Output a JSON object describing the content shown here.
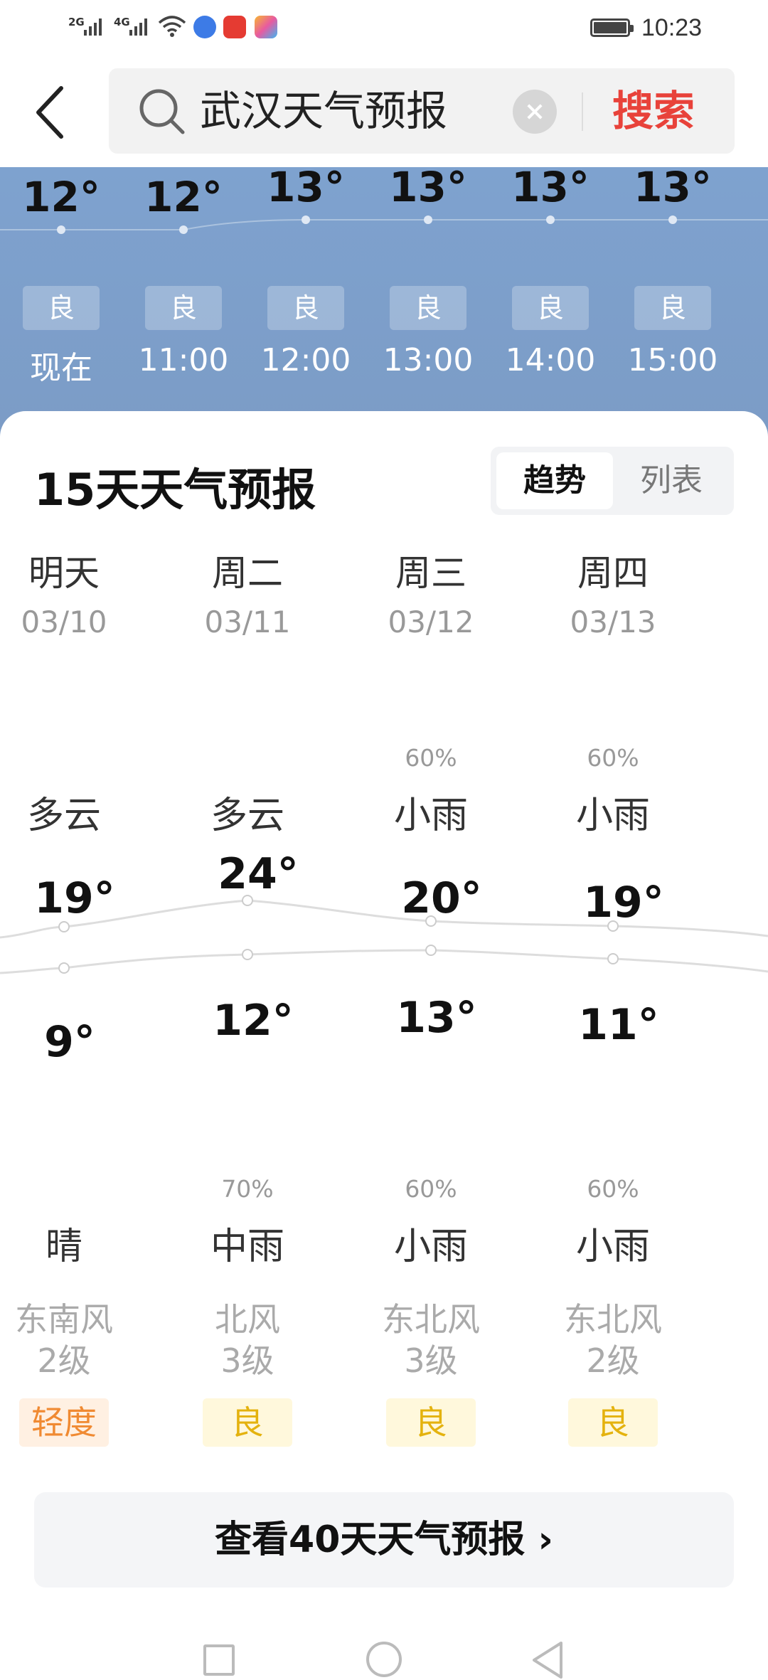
{
  "status_bar": {
    "net1": "2G",
    "net2": "4G",
    "time": "10:23",
    "app_icons": [
      "music-icon",
      "toutiao-icon",
      "store-icon"
    ]
  },
  "search": {
    "query": "武汉天气预报",
    "button_label": "搜索"
  },
  "hourly": {
    "items": [
      {
        "temp": "12°",
        "aqi": "良",
        "time": "现在"
      },
      {
        "temp": "12°",
        "aqi": "良",
        "time": "11:00"
      },
      {
        "temp": "13°",
        "aqi": "良",
        "time": "12:00"
      },
      {
        "temp": "13°",
        "aqi": "良",
        "time": "13:00"
      },
      {
        "temp": "13°",
        "aqi": "良",
        "time": "14:00"
      },
      {
        "temp": "13°",
        "aqi": "良",
        "time": "15:00"
      }
    ]
  },
  "forecast": {
    "title": "15天天气预报",
    "toggle_trend": "趋势",
    "toggle_list": "列表",
    "days": [
      {
        "day": "明天",
        "date": "03/10",
        "day_pct": "",
        "day_cond": "多云",
        "high": "19°",
        "low": "9°",
        "night_pct": "",
        "night_cond": "晴",
        "wind_dir": "东南风",
        "wind_level": "2级",
        "aqi": "轻度",
        "aqi_fg": "#f08a32",
        "aqi_bg": "#fff0e2"
      },
      {
        "day": "周二",
        "date": "03/11",
        "day_pct": "",
        "day_cond": "多云",
        "high": "24°",
        "low": "12°",
        "night_pct": "70%",
        "night_cond": "中雨",
        "wind_dir": "北风",
        "wind_level": "3级",
        "aqi": "良",
        "aqi_fg": "#e4b20e",
        "aqi_bg": "#fff8dc"
      },
      {
        "day": "周三",
        "date": "03/12",
        "day_pct": "60%",
        "day_cond": "小雨",
        "high": "20°",
        "low": "13°",
        "night_pct": "60%",
        "night_cond": "小雨",
        "wind_dir": "东北风",
        "wind_level": "3级",
        "aqi": "良",
        "aqi_fg": "#e4b20e",
        "aqi_bg": "#fff8dc"
      },
      {
        "day": "周四",
        "date": "03/13",
        "day_pct": "60%",
        "day_cond": "小雨",
        "high": "19°",
        "low": "11°",
        "night_pct": "60%",
        "night_cond": "小雨",
        "wind_dir": "东北风",
        "wind_level": "2级",
        "aqi": "良",
        "aqi_fg": "#e4b20e",
        "aqi_bg": "#fff8dc"
      }
    ],
    "more_label": "查看40天天气预报 ›"
  },
  "nav": {
    "items": [
      "recent-apps-icon",
      "home-icon",
      "back-icon"
    ]
  }
}
